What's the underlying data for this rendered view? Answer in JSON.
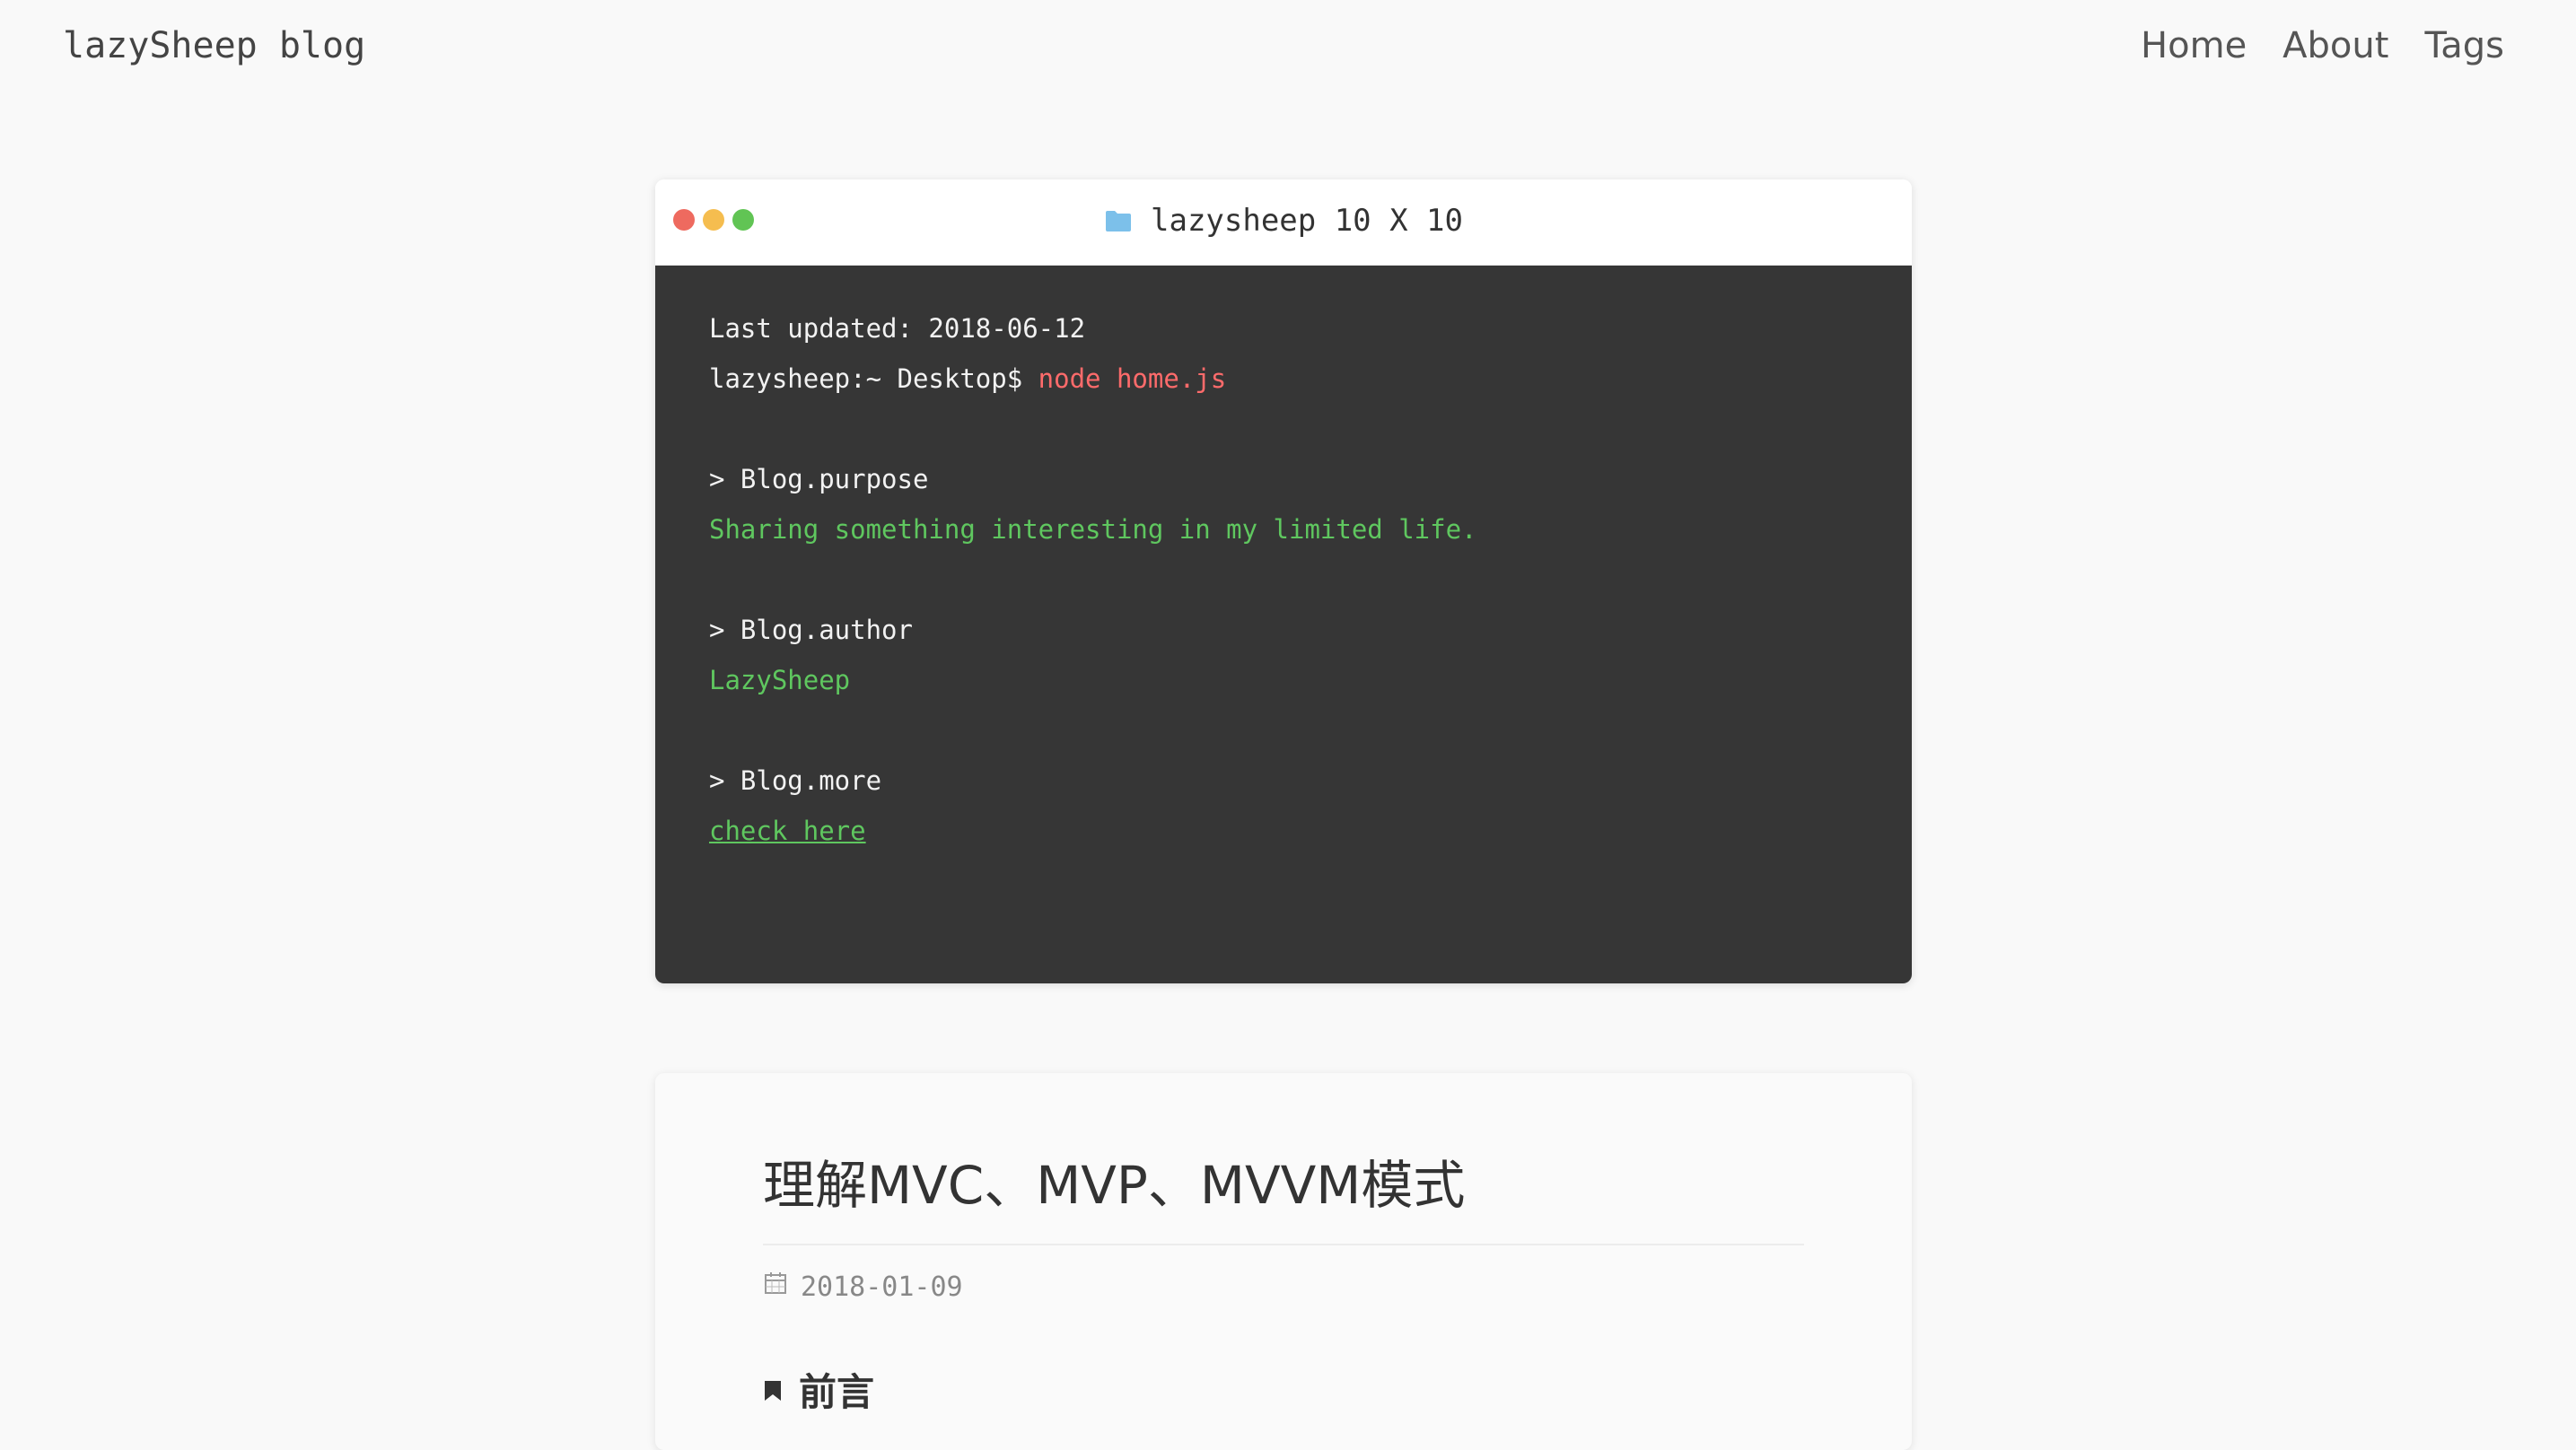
{
  "header": {
    "site_title": "lazySheep blog",
    "nav": [
      {
        "label": "Home"
      },
      {
        "label": "About"
      },
      {
        "label": "Tags"
      }
    ]
  },
  "terminal": {
    "title": "lazysheep 10 X 10",
    "title_icon": "folder-icon",
    "dot_colors": [
      "#ee6a5f",
      "#f5bd4f",
      "#61c454"
    ],
    "lines": {
      "updated": "Last updated: 2018-06-12",
      "prompt": "lazysheep:~ Desktop$ ",
      "command": "node home.js",
      "purpose_key": "> Blog.purpose",
      "purpose_val": "Sharing something interesting in my limited life.",
      "author_key": "> Blog.author",
      "author_val": "LazySheep",
      "more_key": "> Blog.more",
      "more_link": "check here"
    }
  },
  "post": {
    "title": "理解MVC、MVP、MVVM模式",
    "date": "2018-01-09",
    "date_icon": "calendar-icon",
    "section_icon": "bookmark-icon",
    "section_title": "前言"
  },
  "colors": {
    "background": "#f9f9f9",
    "terminal_bg": "#363636",
    "command": "#ff6b6b",
    "output": "#5fc75f",
    "folder": "#7cc0ea"
  }
}
